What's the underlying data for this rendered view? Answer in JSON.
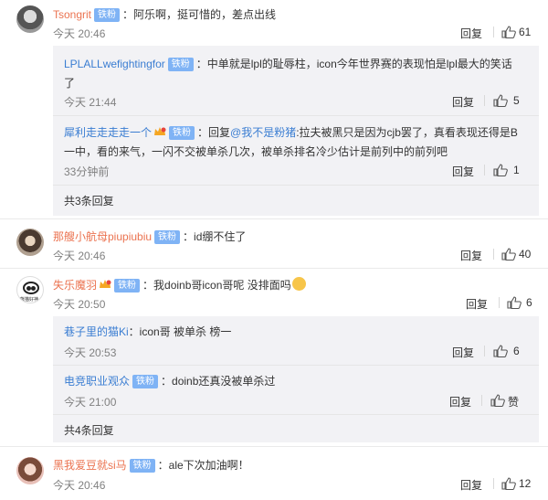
{
  "badge_label": "铁粉",
  "reply_label": "回复",
  "c1": {
    "name": "Tsongrit",
    "text": "：阿乐啊，挺可惜的，差点出线",
    "time": "今天 20:46",
    "likes": "61"
  },
  "c1_replies": [
    {
      "name": "LPLALLwefightingfor",
      "text1": "：中单就是lpl的耻辱柱，icon今年世界赛的表现怕是lpl最大的笑话",
      "text2": "了",
      "time": "今天 21:44",
      "likes": "5"
    },
    {
      "name": "犀利走走走走一个",
      "prefix": "：回复",
      "mention": "@我不是粉猪",
      "text1": ":拉夫被黑只是因为cjb罢了，真看表现还得是B",
      "text2": "一中，看的来气，一闪不交被单杀几次，被单杀排名冷少估计是前列中的前列吧",
      "time": "33分钟前",
      "likes": "1"
    }
  ],
  "c1_more": "共3条回复",
  "c2": {
    "name": "那艘小航母piupiubiu",
    "text": "：id绷不住了",
    "time": "今天 20:46",
    "likes": "40"
  },
  "c3": {
    "name": "失乐魔羽",
    "text": "：我doinb哥icon哥呢 没排面吗",
    "time": "今天 20:50",
    "likes": "6",
    "avatar_caption": "熊猫好神"
  },
  "c3_replies": [
    {
      "name": "巷子里的猫Ki",
      "text": "：icon哥  被单杀  榜一",
      "time": "今天 20:53",
      "likes": "6"
    },
    {
      "name": "电竞职业观众",
      "text": "：doinb还真没被单杀过",
      "time": "今天 21:00",
      "likes": "赞"
    }
  ],
  "c3_more": "共4条回复",
  "c4": {
    "name": "黑我爱豆就si马",
    "text": "：ale下次加油啊！",
    "time": "今天 20:46",
    "likes": "12"
  }
}
